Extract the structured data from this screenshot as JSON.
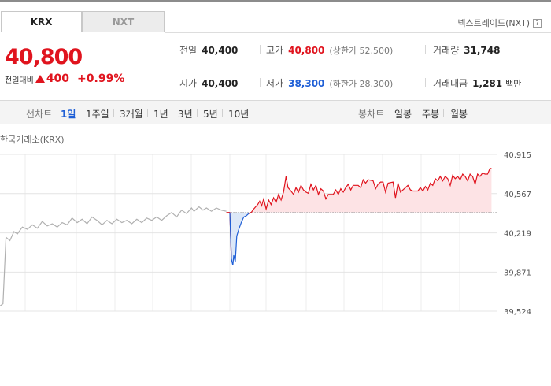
{
  "tabs": [
    {
      "label": "KRX",
      "active": true
    },
    {
      "label": "NXT",
      "active": false
    }
  ],
  "nxt_link": {
    "label": "넥스트레이드(NXT)",
    "icon": "help-icon"
  },
  "price": {
    "current": "40,800",
    "change_label": "전일대비",
    "change": "400",
    "change_pct": "+0.99%",
    "direction": "up"
  },
  "stats": {
    "prev_close": {
      "label": "전일",
      "value": "40,400"
    },
    "open": {
      "label": "시가",
      "value": "40,400"
    },
    "high": {
      "label": "고가",
      "value": "40,800",
      "limit_label": "(상한가 52,500)"
    },
    "low": {
      "label": "저가",
      "value": "38,300",
      "limit_label": "(하한가 28,300)"
    },
    "volume": {
      "label": "거래량",
      "value": "31,748"
    },
    "trade_value": {
      "label": "거래대금",
      "value": "1,281",
      "unit": "백만"
    }
  },
  "period_bar": {
    "line_label": "선차트",
    "line_periods": [
      "1일",
      "1주일",
      "3개월",
      "1년",
      "3년",
      "5년",
      "10년"
    ],
    "selected": "1일",
    "candle_label": "봉차트",
    "candle_periods": [
      "일봉",
      "주봉",
      "월봉"
    ]
  },
  "chart_caption": "한국거래소(KRX)",
  "colors": {
    "up": "#e0141e",
    "down": "#1f5fd6",
    "up_fill": "#fde3e5",
    "down_fill": "#dce8f8",
    "prev_line": "#b0b0b0"
  },
  "chart_data": {
    "type": "line",
    "title": "",
    "xlabel": "",
    "ylabel": "",
    "y_ticks": [
      40915,
      40567,
      40219,
      39871,
      39524
    ],
    "y_tick_labels": [
      "40,915",
      "40,567",
      "40,219",
      "39,871",
      "39,524"
    ],
    "ylim": [
      39524,
      40915
    ],
    "x_range": [
      0,
      100
    ],
    "baseline": 40400,
    "grid": true,
    "series": [
      {
        "part": "previous_session",
        "values": [
          [
            0,
            39570
          ],
          [
            0.6,
            39590
          ],
          [
            1.2,
            40180
          ],
          [
            2,
            40150
          ],
          [
            2.8,
            40230
          ],
          [
            3.5,
            40210
          ],
          [
            4.5,
            40270
          ],
          [
            5.5,
            40250
          ],
          [
            6.5,
            40290
          ],
          [
            7.5,
            40260
          ],
          [
            8.5,
            40320
          ],
          [
            9.5,
            40280
          ],
          [
            10.5,
            40300
          ],
          [
            11.5,
            40270
          ],
          [
            12.5,
            40310
          ],
          [
            13.5,
            40290
          ],
          [
            14.5,
            40350
          ],
          [
            15.5,
            40310
          ],
          [
            16.5,
            40340
          ],
          [
            17.5,
            40300
          ],
          [
            18.5,
            40360
          ],
          [
            19.5,
            40330
          ],
          [
            20.5,
            40290
          ],
          [
            21.5,
            40330
          ],
          [
            22.5,
            40300
          ],
          [
            23.5,
            40340
          ],
          [
            24.5,
            40310
          ],
          [
            25.5,
            40330
          ],
          [
            26.5,
            40300
          ],
          [
            27.5,
            40340
          ],
          [
            28.5,
            40310
          ],
          [
            29.5,
            40350
          ],
          [
            30.5,
            40330
          ],
          [
            31.5,
            40360
          ],
          [
            32.5,
            40330
          ],
          [
            33.5,
            40370
          ],
          [
            34.5,
            40400
          ],
          [
            35.5,
            40360
          ],
          [
            36.5,
            40420
          ],
          [
            37.5,
            40390
          ],
          [
            38.5,
            40440
          ],
          [
            39,
            40410
          ],
          [
            40,
            40450
          ],
          [
            40.8,
            40420
          ],
          [
            41.5,
            40440
          ],
          [
            42.5,
            40410
          ],
          [
            43.5,
            40440
          ],
          [
            44.5,
            40420
          ],
          [
            45.5,
            40410
          ]
        ]
      },
      {
        "part": "today",
        "values": [
          [
            45.5,
            40400
          ],
          [
            46.2,
            40400
          ],
          [
            46.5,
            39990
          ],
          [
            46.8,
            39930
          ],
          [
            47,
            40020
          ],
          [
            47.3,
            39960
          ],
          [
            47.6,
            40190
          ],
          [
            48,
            40250
          ],
          [
            48.5,
            40310
          ],
          [
            49,
            40360
          ],
          [
            49.5,
            40370
          ],
          [
            50,
            40390
          ],
          [
            50.5,
            40400
          ],
          [
            51,
            40430
          ],
          [
            51.4,
            40450
          ],
          [
            51.8,
            40470
          ],
          [
            52.2,
            40500
          ],
          [
            52.6,
            40460
          ],
          [
            53,
            40520
          ],
          [
            53.5,
            40430
          ],
          [
            54,
            40510
          ],
          [
            54.5,
            40470
          ],
          [
            55,
            40530
          ],
          [
            55.5,
            40490
          ],
          [
            56,
            40560
          ],
          [
            56.5,
            40510
          ],
          [
            57,
            40580
          ],
          [
            57.5,
            40720
          ],
          [
            57.9,
            40620
          ],
          [
            58.5,
            40590
          ],
          [
            59,
            40560
          ],
          [
            59.5,
            40620
          ],
          [
            60,
            40580
          ],
          [
            60.5,
            40640
          ],
          [
            61,
            40600
          ],
          [
            61.5,
            40580
          ],
          [
            62,
            40570
          ],
          [
            62.5,
            40650
          ],
          [
            63,
            40600
          ],
          [
            63.5,
            40640
          ],
          [
            64,
            40560
          ],
          [
            64.5,
            40610
          ],
          [
            65,
            40590
          ],
          [
            65.5,
            40520
          ],
          [
            66,
            40560
          ],
          [
            67,
            40560
          ],
          [
            67.5,
            40600
          ],
          [
            68,
            40560
          ],
          [
            68.5,
            40610
          ],
          [
            69,
            40580
          ],
          [
            69.5,
            40620
          ],
          [
            70,
            40650
          ],
          [
            70.5,
            40600
          ],
          [
            71,
            40640
          ],
          [
            72,
            40640
          ],
          [
            72.5,
            40620
          ],
          [
            73,
            40690
          ],
          [
            73.5,
            40660
          ],
          [
            74,
            40690
          ],
          [
            75,
            40680
          ],
          [
            75.5,
            40610
          ],
          [
            76,
            40650
          ],
          [
            76.5,
            40670
          ],
          [
            77,
            40670
          ],
          [
            77.5,
            40580
          ],
          [
            78,
            40660
          ],
          [
            79,
            40670
          ],
          [
            79.5,
            40530
          ],
          [
            80,
            40660
          ],
          [
            80.5,
            40580
          ],
          [
            81,
            40600
          ],
          [
            81.5,
            40620
          ],
          [
            82,
            40640
          ],
          [
            82.5,
            40600
          ],
          [
            83,
            40590
          ],
          [
            84,
            40590
          ],
          [
            84.5,
            40620
          ],
          [
            85,
            40590
          ],
          [
            85.5,
            40630
          ],
          [
            86,
            40600
          ],
          [
            86.5,
            40660
          ],
          [
            87,
            40640
          ],
          [
            87.5,
            40700
          ],
          [
            88,
            40680
          ],
          [
            88.5,
            40720
          ],
          [
            89,
            40680
          ],
          [
            89.5,
            40720
          ],
          [
            90,
            40700
          ],
          [
            90.5,
            40640
          ],
          [
            91,
            40730
          ],
          [
            91.5,
            40700
          ],
          [
            92,
            40720
          ],
          [
            92.5,
            40690
          ],
          [
            93,
            40740
          ],
          [
            93.5,
            40720
          ],
          [
            94,
            40680
          ],
          [
            94.5,
            40740
          ],
          [
            95,
            40720
          ],
          [
            95.5,
            40650
          ],
          [
            96,
            40740
          ],
          [
            96.5,
            40720
          ],
          [
            97,
            40750
          ],
          [
            97.5,
            40740
          ],
          [
            98,
            40740
          ],
          [
            98.5,
            40790
          ],
          [
            98.8,
            40790
          ]
        ]
      }
    ]
  }
}
